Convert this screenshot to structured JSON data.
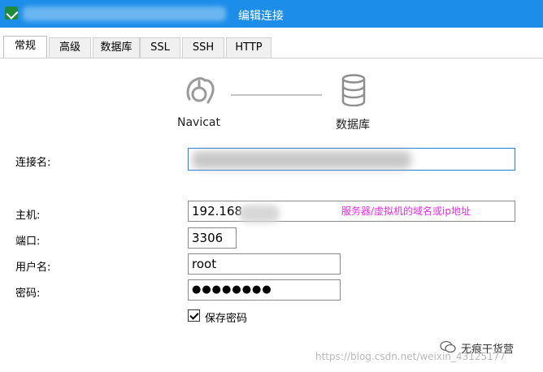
{
  "window": {
    "title": "编辑连接"
  },
  "tabs": [
    "常规",
    "高级",
    "数据库",
    "SSL",
    "SSH",
    "HTTP"
  ],
  "diagram": {
    "source_label": "Navicat",
    "target_label": "数据库",
    "source_icon": "navicat-icon",
    "target_icon": "database-icon"
  },
  "form": {
    "connection_name": {
      "label": "连接名:",
      "value": ""
    },
    "host": {
      "label": "主机:",
      "value": "192.168"
    },
    "port": {
      "label": "端口:",
      "value": "3306"
    },
    "username": {
      "label": "用户名:",
      "value": "root"
    },
    "password": {
      "label": "密码:",
      "value": "●●●●●●●●"
    },
    "save_password": {
      "label": "保存密码",
      "checked": true
    }
  },
  "annotation": "服务器/虚拟机的域名或ip地址",
  "watermark": {
    "brand": "无痕干货营",
    "url": "https://blog.csdn.net/weixin_43125177"
  },
  "colors": {
    "titlebar": "#1c8ee9",
    "annotation": "#e62ee6",
    "focus_border": "#2a7fd4"
  }
}
